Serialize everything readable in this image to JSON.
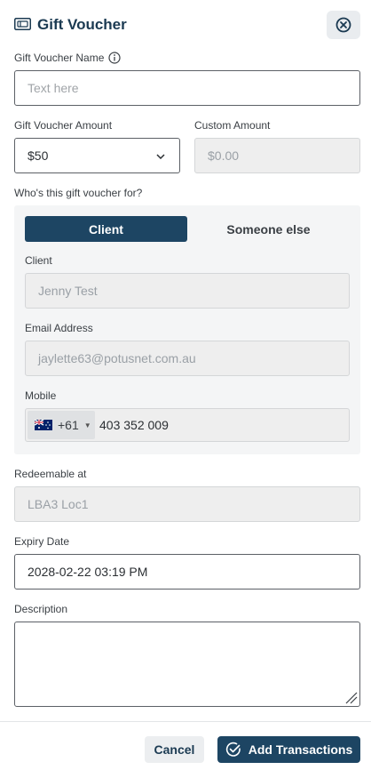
{
  "header": {
    "title": "Gift Voucher",
    "title_icon": "voucher-icon",
    "close_icon": "close-circle-icon"
  },
  "voucher_name": {
    "label": "Gift Voucher Name",
    "info_icon": "info-icon",
    "placeholder": "Text here",
    "value": ""
  },
  "amount": {
    "label": "Gift Voucher Amount",
    "selected": "$50",
    "dropdown_icon": "chevron-down-icon"
  },
  "custom_amount": {
    "label": "Custom Amount",
    "placeholder": "$0.00"
  },
  "recipient": {
    "question": "Who's this gift voucher for?",
    "options": [
      "Client",
      "Someone else"
    ],
    "selected": "Client",
    "client_label": "Client",
    "client_value": "Jenny Test",
    "email_label": "Email Address",
    "email_value": "jaylette63@potusnet.com.au",
    "mobile_label": "Mobile",
    "country_flag": "australia-flag-icon",
    "country_code": "+61",
    "mobile_value": "403 352 009"
  },
  "redeemable": {
    "label": "Redeemable at",
    "value": "LBA3 Loc1"
  },
  "expiry": {
    "label": "Expiry Date",
    "value": "2028-02-22 03:19 PM"
  },
  "description": {
    "label": "Description",
    "value": ""
  },
  "footer": {
    "cancel_label": "Cancel",
    "add_label": "Add Transactions",
    "add_icon": "check-circle-icon"
  },
  "colors": {
    "primary": "#1d4563",
    "disabled_bg": "#eeeeee",
    "panel_bg": "#f4f5f6"
  }
}
